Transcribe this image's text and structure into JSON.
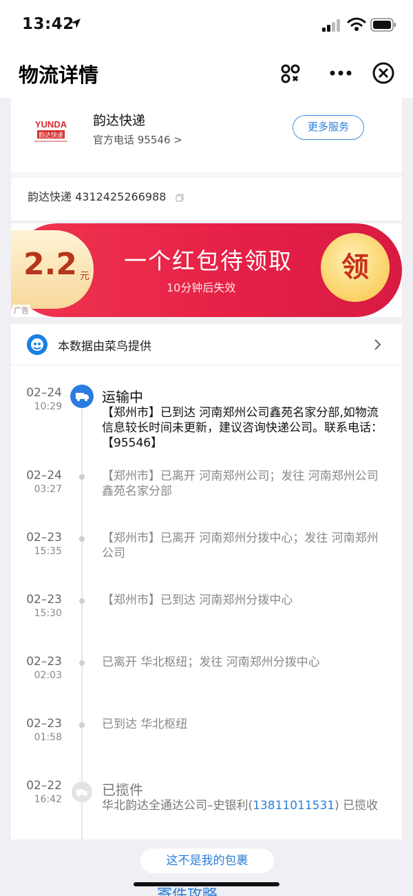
{
  "status_bar": {
    "time": "13:42"
  },
  "header": {
    "title": "物流详情"
  },
  "courier": {
    "name": "韵达快递",
    "phone_label": "官方电话 95546 >",
    "more_service": "更多服务",
    "tracking": "韵达快递 4312425266988",
    "logo_text_top": "YUNDA",
    "logo_text_bottom": "韵达快递"
  },
  "ad": {
    "amount": "2.2",
    "unit": "元",
    "title": "一个红包待领取",
    "subtitle": "10分钟后失效",
    "claim": "领",
    "label": "广告"
  },
  "provider": {
    "text": "本数据由菜鸟提供"
  },
  "events": [
    {
      "date": "02–24",
      "time": "10:29",
      "status": "运输中",
      "detail_prefix": "【郑州市】已到达 河南郑州公司鑫苑名家分部,如物流信息较长时间未更新，建议咨询快递公司。联系电话：【95546】"
    },
    {
      "date": "02–24",
      "time": "03:27",
      "text": "【郑州市】已离开 河南郑州公司；发往 河南郑州公司鑫苑名家分部"
    },
    {
      "date": "02–23",
      "time": "15:35",
      "text": "【郑州市】已离开 河南郑州分拨中心；发往 河南郑州公司"
    },
    {
      "date": "02–23",
      "time": "15:30",
      "text": "【郑州市】已到达 河南郑州分拨中心"
    },
    {
      "date": "02–23",
      "time": "02:03",
      "text": "已离开 华北枢纽；发往 河南郑州分拨中心"
    },
    {
      "date": "02–23",
      "time": "01:58",
      "text": "已到达 华北枢纽"
    },
    {
      "date": "02–22",
      "time": "16:42",
      "status": "已揽件",
      "detail_prefix": "华北韵达全通达公司–史银利(",
      "detail_phone": "13811011531",
      "detail_suffix": ") 已揽收"
    }
  ],
  "bottom": {
    "not_mine": "这不是我的包裹",
    "peek_text": "寄件攻略"
  },
  "colors": {
    "accent_blue": "#2d7fd8",
    "ad_red": "#e62147",
    "truck_blue": "#2b7be0"
  }
}
